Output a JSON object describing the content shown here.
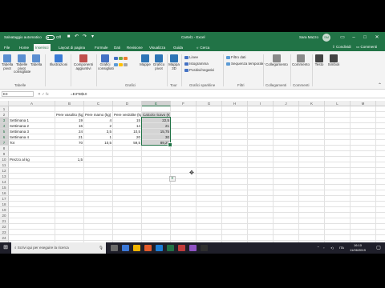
{
  "titlebar": {
    "autosave": "Salvataggio automatico",
    "autosave_state": "Off",
    "doc_title": "Cartel1 - Excel",
    "user": "Sara Mazzo",
    "avatar": "SM"
  },
  "tabs": [
    "File",
    "Home",
    "Inserisci",
    "Layout di pagina",
    "Formule",
    "Dati",
    "Revisione",
    "Visualizza",
    "Guida",
    "Cerca"
  ],
  "share_label": "Condividi",
  "comments_label": "Commenti",
  "ribbon": {
    "items": [
      {
        "label": "Tabella pivot",
        "color": "#5b8fd1"
      },
      {
        "label": "Tabelle pivot consigliate",
        "color": "#5b8fd1"
      },
      {
        "label": "Tabella",
        "color": "#5b8fd1"
      },
      {
        "label": "Illustrazioni",
        "color": "#3a7bd5"
      },
      {
        "label": "Componenti aggiuntivi",
        "color": "#c0504d"
      },
      {
        "label": "Grafici consigliati",
        "color": "#4472c4"
      },
      {
        "label": "Mappe",
        "color": "#2e75b6"
      },
      {
        "label": "Grafico pivot",
        "color": "#2e75b6"
      },
      {
        "label": "Mappa 3D",
        "color": "#2e75b6"
      },
      {
        "label": "Testo",
        "color": "#444444"
      },
      {
        "label": "Simboli",
        "color": "#444444"
      }
    ],
    "sparklines": [
      "Linee",
      "Istogramma",
      "Positivi/negativi"
    ],
    "filters": [
      "Filtro dati",
      "Sequenza temporale"
    ],
    "links": "Collegamento",
    "comment": "Commento",
    "groups": [
      "Tabelle",
      "Grafici",
      "Tour",
      "Grafici sparkline",
      "Filtri",
      "Collegamenti",
      "Commenti"
    ]
  },
  "formula_bar": {
    "name_box": "E3",
    "fx": "fx",
    "formula": "=E3*B$10"
  },
  "columns": [
    "A",
    "B",
    "C",
    "D",
    "E",
    "F",
    "G",
    "H",
    "I",
    "J",
    "K",
    "L",
    "M",
    "N",
    "O"
  ],
  "rows": [
    "1",
    "2",
    "3",
    "4",
    "5",
    "6",
    "7",
    "8",
    "9",
    "10",
    "11",
    "12",
    "13",
    "14",
    "15",
    "16",
    "17",
    "18",
    "19",
    "20",
    "21",
    "22",
    "23",
    "24",
    "25"
  ],
  "cells": {
    "headers": [
      "Pere vasolito (kg)",
      "Pere mamo (kg)",
      "Pere verdolite (kg)",
      "Calcolo ricavo (€)"
    ],
    "rows": [
      {
        "label": "Settimana 1",
        "b": "19",
        "c": "4",
        "d": "15",
        "e": "22,5"
      },
      {
        "label": "Settimana 2",
        "b": "16",
        "c": "2",
        "d": "14",
        "e": "21"
      },
      {
        "label": "Settimana 3",
        "b": "24",
        "c": "3,5",
        "d": "10,5",
        "e": "15,75"
      },
      {
        "label": "Settimana 4",
        "b": "21",
        "c": "1",
        "d": "20",
        "e": "30"
      },
      {
        "label": "Tot",
        "b": "70",
        "c": "10,5",
        "d": "59,5",
        "e": "89,25"
      }
    ],
    "price_label": "Prezzo al kg",
    "price_value": "1,5"
  },
  "sheet_tab": "Foglio1",
  "status": {
    "left": "Pronto",
    "media": "Media: 35,7",
    "count": "Conteggio: 5",
    "sum": "Somma: 178,5",
    "zoom": "100%"
  },
  "taskbar": {
    "search_placeholder": "Scrivi qui per eseguire la ricerca",
    "time": "16:10",
    "date": "11/06/2019",
    "app_colors": [
      "#6a6a6a",
      "#3b78d8",
      "#f0b400",
      "#e35a2a",
      "#1c7ed6",
      "#217346",
      "#c13b3b",
      "#8f52c4",
      "#2f2f2f"
    ]
  }
}
